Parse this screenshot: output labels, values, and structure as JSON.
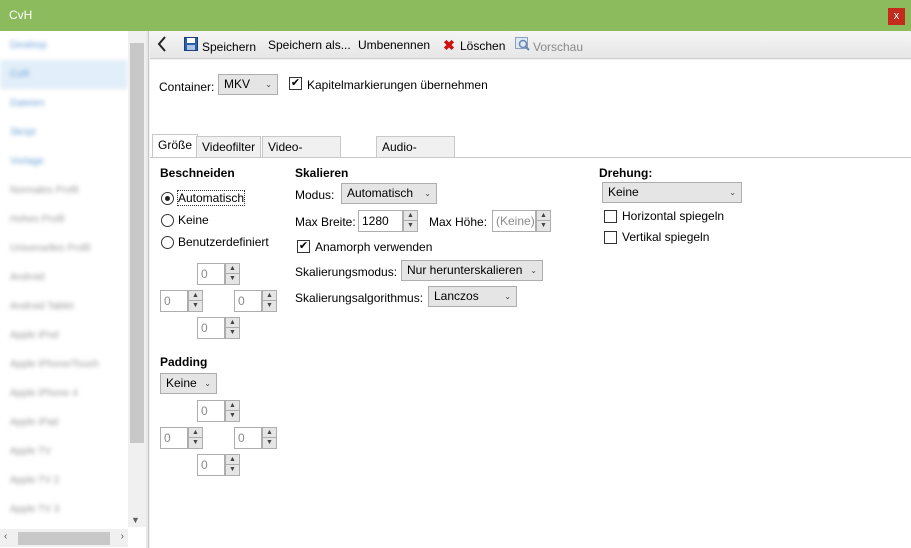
{
  "window": {
    "title": "CvH",
    "close_label": "x"
  },
  "sidebar": {
    "items": [
      "Desktop",
      "CvR",
      "Dateien",
      "Skript",
      "Vorlage",
      "Normales Profil",
      "Hohes Profil",
      "Universelles Profil",
      "Android",
      "Android Tablet",
      "Apple iPod",
      "Apple iPhone/Touch",
      "Apple iPhone 4",
      "Apple iPad",
      "Apple TV",
      "Apple TV 2",
      "Apple TV 3"
    ]
  },
  "toolbar": {
    "back_icon": "chevron-left-icon",
    "save": "Speichern",
    "save_as": "Speichern als...",
    "rename": "Umbenennen",
    "delete": "Löschen",
    "preview": "Vorschau"
  },
  "container": {
    "label": "Container:",
    "value": "MKV",
    "chapter_label": "Kapitelmarkierungen übernehmen",
    "chapter_checked": true
  },
  "tabs": [
    "Größe",
    "Videofilter",
    "Video-Encodierung",
    "Audio-Encodierung"
  ],
  "crop": {
    "title": "Beschneiden",
    "options": [
      "Automatisch",
      "Keine",
      "Benutzerdefiniert"
    ],
    "selected": "Automatisch",
    "top": "0",
    "left": "0",
    "right": "0",
    "bottom": "0"
  },
  "padding": {
    "title": "Padding",
    "mode": "Keine",
    "top": "0",
    "left": "0",
    "right": "0",
    "bottom": "0"
  },
  "scaling": {
    "title": "Skalieren",
    "mode_label": "Modus:",
    "mode": "Automatisch",
    "max_width_label": "Max Breite:",
    "max_width": "1280",
    "max_height_label": "Max Höhe:",
    "max_height": "(Keine)",
    "anamorph_label": "Anamorph verwenden",
    "anamorph_checked": true,
    "scale_mode_label": "Skalierungsmodus:",
    "scale_mode": "Nur herunterskalieren",
    "algorithm_label": "Skalierungsalgorithmus:",
    "algorithm": "Lanczos"
  },
  "rotation": {
    "title": "Drehung:",
    "value": "Keine",
    "flip_h_label": "Horizontal spiegeln",
    "flip_h_checked": false,
    "flip_v_label": "Vertikal spiegeln",
    "flip_v_checked": false
  }
}
